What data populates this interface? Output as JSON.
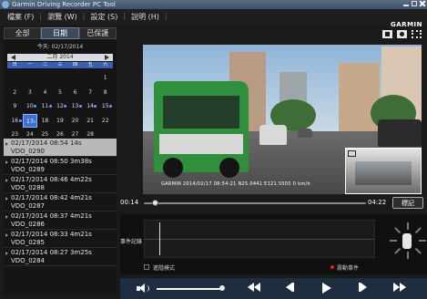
{
  "window": {
    "title": "Garmin Driving Recorder PC Tool"
  },
  "menu": {
    "items": [
      "檔案 (F)",
      "瀏覽 (W)",
      "設定 (S)",
      "說明 (H)"
    ]
  },
  "brand": "GARMIN",
  "tabs": [
    {
      "label": "全部"
    },
    {
      "label": "日期"
    },
    {
      "label": "已保護"
    }
  ],
  "calendar": {
    "today": "今天: 02/17/2014",
    "month": "二月 2014",
    "weekdays": [
      "日",
      "一",
      "二",
      "三",
      "四",
      "五",
      "六"
    ],
    "days": [
      "",
      "",
      "",
      "",
      "",
      "",
      "1",
      "2",
      "3",
      "4",
      "5",
      "6",
      "7",
      "8",
      "9",
      "10",
      "11",
      "12",
      "13",
      "14",
      "15",
      "16",
      "17",
      "18",
      "19",
      "20",
      "21",
      "22",
      "23",
      "24",
      "25",
      "26",
      "27",
      "28",
      ""
    ],
    "selected_day": "17",
    "recorded_days": [
      "10",
      "11",
      "12",
      "13",
      "14",
      "15",
      "16",
      "17"
    ]
  },
  "files": [
    {
      "line1": "02/17/2014 08:54 14s",
      "line2": "VDO_0290",
      "active": true
    },
    {
      "line1": "02/17/2014 08:50 3m38s",
      "line2": "VDO_0289",
      "active": false
    },
    {
      "line1": "02/17/2014 08:46 4m22s",
      "line2": "VDO_0288",
      "active": false
    },
    {
      "line1": "02/17/2014 08:42 4m21s",
      "line2": "VDO_0287",
      "active": false
    },
    {
      "line1": "02/17/2014 08:37 4m21s",
      "line2": "VDO_0286",
      "active": false
    },
    {
      "line1": "02/17/2014 08:33 4m21s",
      "line2": "VDO_0285",
      "active": false
    },
    {
      "line1": "02/17/2014 08:27 3m25s",
      "line2": "VDO_0284",
      "active": false
    }
  ],
  "video": {
    "osd": "GARMIN 2014/02/17 08:54:21  N25.0441 E121.5505  0 km/h"
  },
  "playback": {
    "current_time": "00:14",
    "total_time": "04:22",
    "progress": 0.05,
    "mark_button": "標記",
    "volume": 0.97
  },
  "events": {
    "label": "事件記錄",
    "checkbox_label": "進階模式",
    "legend": "震動事件",
    "legend_color": "#e02020"
  },
  "icons": {
    "layout": "layout-icon",
    "snapshot": "camera-icon",
    "fullscreen": "fullscreen-icon",
    "volume": "speaker-icon",
    "rewind": "rewind-icon",
    "prev_frame": "previous-frame-icon",
    "play": "play-icon",
    "next_frame": "next-frame-icon",
    "fast_forward": "fast-forward-icon"
  }
}
